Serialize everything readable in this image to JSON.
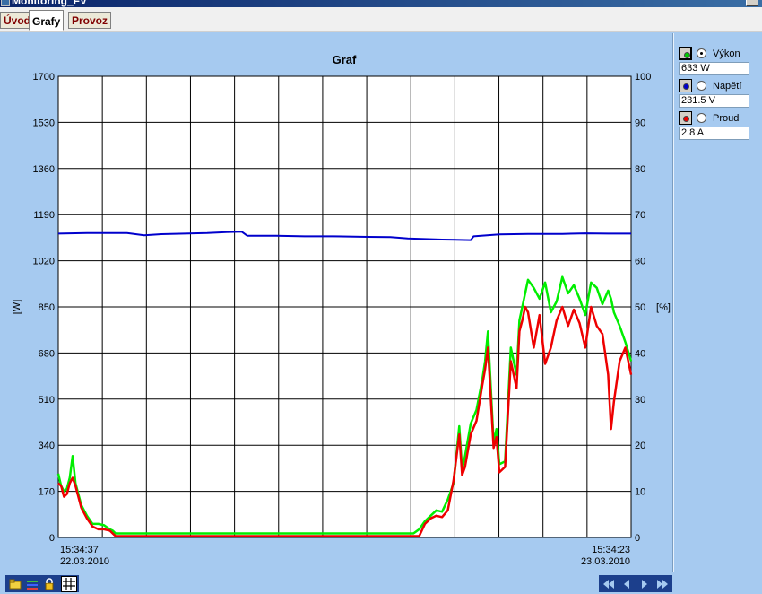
{
  "window": {
    "title": "Monitoring_FV"
  },
  "tabs": [
    {
      "label": "Úvod",
      "active": false
    },
    {
      "label": "Grafy",
      "active": true
    },
    {
      "label": "Provoz",
      "active": false
    }
  ],
  "legend": {
    "items": [
      {
        "label": "Výkon",
        "value": "633 W",
        "color": "#00cc00",
        "selected": true
      },
      {
        "label": "Napětí",
        "value": "231.5 V",
        "color": "#0000cc",
        "selected": false
      },
      {
        "label": "Proud",
        "value": "2.8 A",
        "color": "#ee0000",
        "selected": false
      }
    ]
  },
  "toolbar": {
    "icons": [
      "folder-icon",
      "layers-icon",
      "lock-icon",
      "grid-icon"
    ]
  },
  "nav": {
    "icons": [
      "first-icon",
      "prev-icon",
      "next-icon",
      "last-icon"
    ]
  },
  "chart_data": {
    "type": "line",
    "title": "Graf",
    "ylabel": "[W]",
    "y2label": "[%]",
    "ylim": [
      0,
      1700
    ],
    "y2lim": [
      0,
      100
    ],
    "yticks": [
      0,
      170,
      340,
      510,
      680,
      850,
      1020,
      1190,
      1360,
      1530,
      1700
    ],
    "y2ticks": [
      0,
      10,
      20,
      30,
      40,
      50,
      60,
      70,
      80,
      90,
      100
    ],
    "x_start": {
      "time": "15:34:37",
      "date": "22.03.2010"
    },
    "x_end": {
      "time": "15:34:23",
      "date": "23.03.2010"
    },
    "grid": true,
    "series": [
      {
        "color": "#0000cc",
        "points": [
          [
            0,
            1120
          ],
          [
            5,
            1122
          ],
          [
            9,
            1122
          ],
          [
            12,
            1122
          ],
          [
            15,
            1114
          ],
          [
            18,
            1118
          ],
          [
            22,
            1120
          ],
          [
            26,
            1122
          ],
          [
            30,
            1126
          ],
          [
            32,
            1127
          ],
          [
            33,
            1112
          ],
          [
            38,
            1112
          ],
          [
            43,
            1110
          ],
          [
            48,
            1110
          ],
          [
            54,
            1108
          ],
          [
            58,
            1107
          ],
          [
            61,
            1102
          ],
          [
            64,
            1100
          ],
          [
            67,
            1098
          ],
          [
            72,
            1096
          ],
          [
            72.5,
            1110
          ],
          [
            77,
            1117
          ],
          [
            82,
            1119
          ],
          [
            88,
            1119
          ],
          [
            92,
            1121
          ],
          [
            96,
            1120
          ],
          [
            100,
            1120
          ]
        ]
      },
      {
        "color": "#00ee00",
        "points": [
          [
            0,
            235
          ],
          [
            0.5,
            190
          ],
          [
            1,
            170
          ],
          [
            1.5,
            180
          ],
          [
            2,
            220
          ],
          [
            2.5,
            300
          ],
          [
            3,
            200
          ],
          [
            4,
            120
          ],
          [
            5,
            80
          ],
          [
            6,
            50
          ],
          [
            7,
            50
          ],
          [
            8,
            45
          ],
          [
            9,
            30
          ],
          [
            9.5,
            25
          ],
          [
            10,
            15
          ],
          [
            62,
            15
          ],
          [
            63,
            30
          ],
          [
            64,
            60
          ],
          [
            65,
            80
          ],
          [
            66,
            100
          ],
          [
            67,
            95
          ],
          [
            68,
            140
          ],
          [
            69,
            200
          ],
          [
            70,
            410
          ],
          [
            70.5,
            250
          ],
          [
            71,
            300
          ],
          [
            72,
            420
          ],
          [
            73,
            470
          ],
          [
            74,
            580
          ],
          [
            74.5,
            650
          ],
          [
            75,
            760
          ],
          [
            76,
            350
          ],
          [
            76.5,
            400
          ],
          [
            77,
            270
          ],
          [
            78,
            280
          ],
          [
            79,
            700
          ],
          [
            80,
            600
          ],
          [
            80.5,
            800
          ],
          [
            81,
            850
          ],
          [
            81.5,
            900
          ],
          [
            82,
            950
          ],
          [
            83,
            920
          ],
          [
            84,
            880
          ],
          [
            85,
            940
          ],
          [
            86,
            830
          ],
          [
            87,
            870
          ],
          [
            88,
            960
          ],
          [
            89,
            900
          ],
          [
            90,
            930
          ],
          [
            91,
            880
          ],
          [
            92,
            820
          ],
          [
            93,
            940
          ],
          [
            94,
            920
          ],
          [
            95,
            860
          ],
          [
            96,
            910
          ],
          [
            96.5,
            880
          ],
          [
            97,
            830
          ],
          [
            98,
            780
          ],
          [
            99,
            720
          ],
          [
            100,
            650
          ]
        ]
      },
      {
        "color": "#ee0000",
        "points": [
          [
            0,
            200
          ],
          [
            0.5,
            190
          ],
          [
            1,
            150
          ],
          [
            1.5,
            160
          ],
          [
            2,
            200
          ],
          [
            2.5,
            220
          ],
          [
            3,
            190
          ],
          [
            4,
            110
          ],
          [
            5,
            70
          ],
          [
            6,
            40
          ],
          [
            7,
            30
          ],
          [
            8,
            30
          ],
          [
            9,
            25
          ],
          [
            9.5,
            15
          ],
          [
            10,
            5
          ],
          [
            63,
            5
          ],
          [
            64,
            50
          ],
          [
            65,
            70
          ],
          [
            66,
            80
          ],
          [
            67,
            75
          ],
          [
            68,
            100
          ],
          [
            69,
            210
          ],
          [
            70,
            380
          ],
          [
            70.5,
            230
          ],
          [
            71,
            260
          ],
          [
            72,
            380
          ],
          [
            73,
            430
          ],
          [
            74,
            560
          ],
          [
            74.5,
            620
          ],
          [
            75,
            700
          ],
          [
            76,
            330
          ],
          [
            76.5,
            370
          ],
          [
            77,
            240
          ],
          [
            78,
            260
          ],
          [
            79,
            650
          ],
          [
            80,
            550
          ],
          [
            80.5,
            760
          ],
          [
            81,
            800
          ],
          [
            81.5,
            850
          ],
          [
            82,
            830
          ],
          [
            83,
            700
          ],
          [
            84,
            820
          ],
          [
            85,
            640
          ],
          [
            86,
            700
          ],
          [
            87,
            800
          ],
          [
            88,
            850
          ],
          [
            89,
            780
          ],
          [
            90,
            840
          ],
          [
            91,
            790
          ],
          [
            92,
            700
          ],
          [
            93,
            850
          ],
          [
            94,
            780
          ],
          [
            95,
            750
          ],
          [
            96,
            600
          ],
          [
            96.5,
            400
          ],
          [
            97,
            500
          ],
          [
            98,
            650
          ],
          [
            99,
            700
          ],
          [
            100,
            600
          ]
        ]
      }
    ]
  }
}
